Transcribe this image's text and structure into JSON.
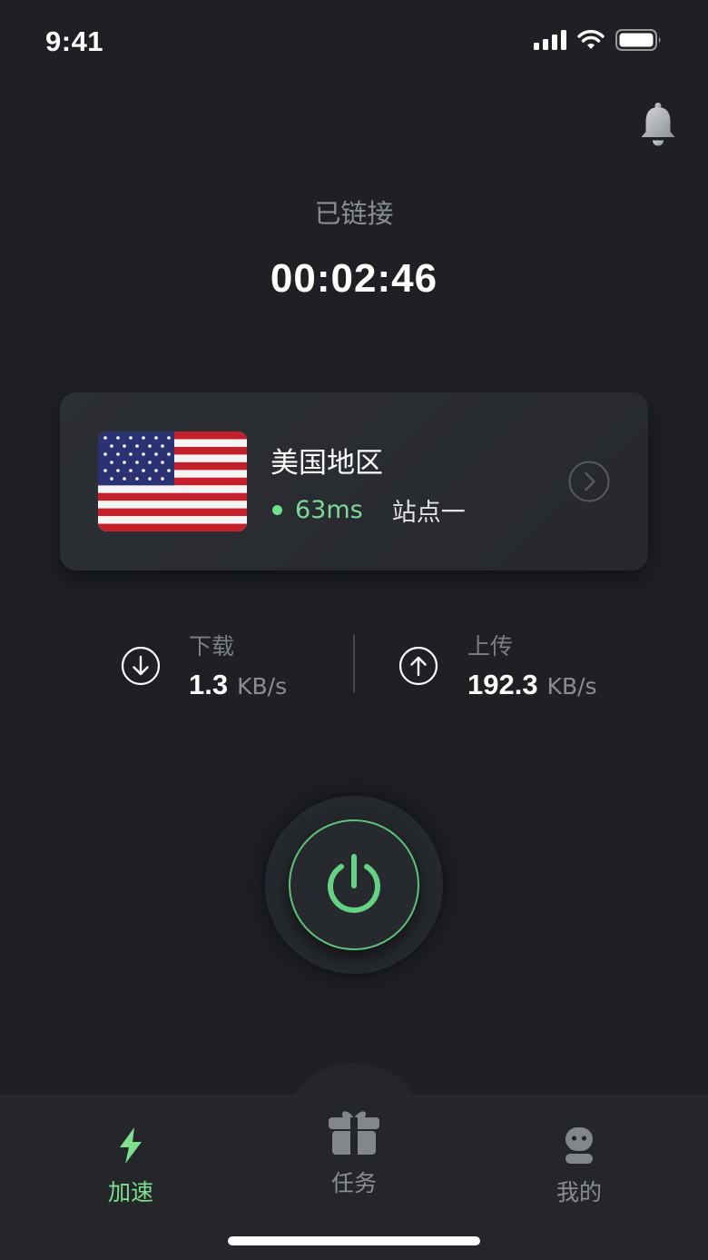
{
  "status_bar": {
    "time": "9:41",
    "signal_icon": "cellular-signal-icon",
    "wifi_icon": "wifi-icon",
    "battery_icon": "battery-icon"
  },
  "header": {
    "notification_icon": "bell-icon"
  },
  "connection": {
    "status": "已链接",
    "elapsed": "00:02:46"
  },
  "server": {
    "flag_icon": "us-flag-icon",
    "name": "美国地区",
    "ping": "63ms",
    "station": "站点一",
    "ping_color": "#6ee08c"
  },
  "traffic": {
    "download": {
      "label": "下载",
      "value": "1.3",
      "unit": "KB/s",
      "icon": "download-arrow-icon"
    },
    "upload": {
      "label": "上传",
      "value": "192.3",
      "unit": "KB/s",
      "icon": "upload-arrow-icon"
    }
  },
  "power": {
    "icon": "power-icon",
    "accent": "#5fc27c"
  },
  "tabs": [
    {
      "label": "加速",
      "icon": "lightning-icon",
      "active": true
    },
    {
      "label": "任务",
      "icon": "gift-box-icon",
      "active": false
    },
    {
      "label": "我的",
      "icon": "robot-profile-icon",
      "active": false
    }
  ],
  "colors": {
    "background": "#1e2024",
    "accent_green": "#7ee08e",
    "card": "#2a2d32"
  }
}
